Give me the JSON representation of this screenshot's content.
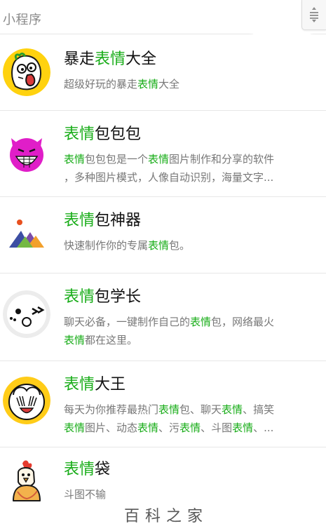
{
  "header": {
    "section_label": "小程序",
    "menu_icon": "triple-bar-sort-icon"
  },
  "colors": {
    "highlight": "#19ad19",
    "title_text": "#111111",
    "desc_text": "#777777",
    "divider": "#e7e7e7"
  },
  "results": [
    {
      "icon": "rage-face-icon",
      "title": {
        "pre": "暴走",
        "hl": "表情",
        "post": "大全"
      },
      "desc": [
        {
          "pre": "超级好玩的暴走",
          "hl": "表情",
          "post": "大全"
        }
      ]
    },
    {
      "icon": "pink-grin-devil-icon",
      "title": {
        "pre": "",
        "hl": "表情",
        "post": "包包包"
      },
      "desc": [
        {
          "pre": "",
          "hl": "表情",
          "post": "包包包是一个",
          "hl2": "表情",
          "post2": "图片制作和分享的软件"
        },
        {
          "pre": "，多种图片模式，人像自动识别，海量文字...",
          "hl": "",
          "post": ""
        }
      ]
    },
    {
      "icon": "mountain-triangles-icon",
      "title": {
        "pre": "",
        "hl": "表情",
        "post": "包神器"
      },
      "desc": [
        {
          "pre": "快速制作你的专属",
          "hl": "表情",
          "post": "包。"
        }
      ]
    },
    {
      "icon": "wink-face-icon",
      "title": {
        "pre": "",
        "hl": "表情",
        "post": "包学长"
      },
      "desc": [
        {
          "pre": "聊天必备，一键制作自己的",
          "hl": "表情",
          "post": "包，网络最火"
        },
        {
          "pre": "",
          "hl": "表情",
          "post": "都在这里。"
        }
      ]
    },
    {
      "icon": "laughing-face-icon",
      "title": {
        "pre": "",
        "hl": "表情",
        "post": "大王"
      },
      "desc": [
        {
          "pre": "每天为你推荐最热门",
          "hl": "表情",
          "post": "包、聊天",
          "hl2": "表情",
          "post2": "、搞笑"
        },
        {
          "pre": "",
          "hl": "表情",
          "post": "图片、动态",
          "hl2": "表情",
          "post2": "、污",
          "hl3": "表情",
          "post3": "、斗图",
          "hl4": "表情",
          "post4": "、..."
        }
      ]
    },
    {
      "icon": "rooster-cartoon-icon",
      "title": {
        "pre": "",
        "hl": "表情",
        "post": "袋"
      },
      "desc": [
        {
          "pre": "斗图不输",
          "hl": "",
          "post": ""
        }
      ]
    }
  ],
  "watermark": "百科之家"
}
